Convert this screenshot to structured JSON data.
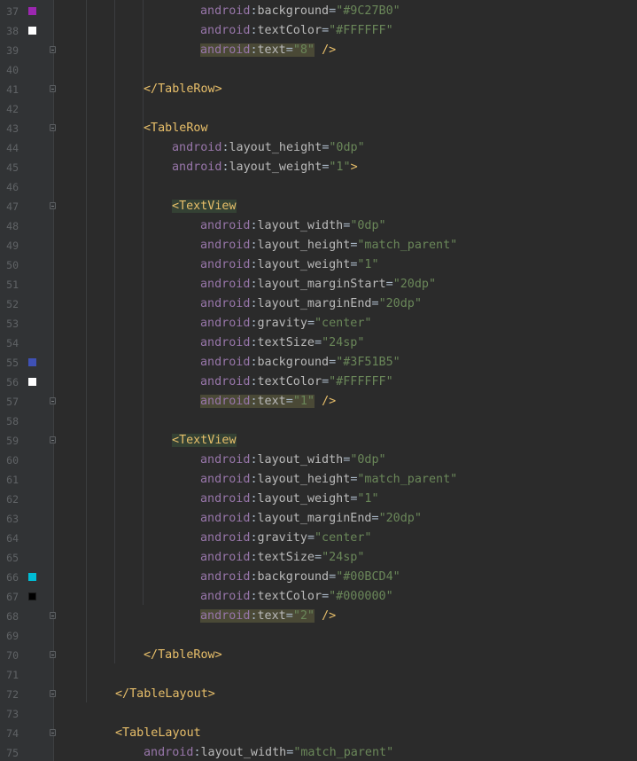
{
  "editor": {
    "colors": {
      "background": "#2b2b2b",
      "gutter": "#313335",
      "line_number": "#606366",
      "namespace": "#9876aa",
      "attribute": "#bababa",
      "value": "#6a8759",
      "tag": "#e8bf6a"
    },
    "lines": [
      {
        "num": "37",
        "indent": 4,
        "swatch": "#9C27B0",
        "fold": false,
        "tokens": [
          {
            "t": "ns",
            "s": "android"
          },
          {
            "t": "plain",
            "s": ":"
          },
          {
            "t": "attr",
            "s": "background"
          },
          {
            "t": "plain",
            "s": "="
          },
          {
            "t": "val",
            "s": "\"#9C27B0\""
          }
        ]
      },
      {
        "num": "38",
        "indent": 4,
        "swatch": "#FFFFFF",
        "fold": false,
        "tokens": [
          {
            "t": "ns",
            "s": "android"
          },
          {
            "t": "plain",
            "s": ":"
          },
          {
            "t": "attr",
            "s": "textColor"
          },
          {
            "t": "plain",
            "s": "="
          },
          {
            "t": "val",
            "s": "\"#FFFFFF\""
          }
        ]
      },
      {
        "num": "39",
        "indent": 4,
        "fold": true,
        "tokens": [
          {
            "t": "ns",
            "s": "android",
            "hl": "text"
          },
          {
            "t": "plain",
            "s": ":",
            "hl": "text"
          },
          {
            "t": "attr",
            "s": "text",
            "hl": "text"
          },
          {
            "t": "plain",
            "s": "=",
            "hl": "text"
          },
          {
            "t": "val",
            "s": "\"8\"",
            "hl": "text"
          },
          {
            "t": "plain",
            "s": " "
          },
          {
            "t": "punc",
            "s": "/>"
          }
        ]
      },
      {
        "num": "40",
        "indent": 0,
        "fold": false,
        "tokens": []
      },
      {
        "num": "41",
        "indent": 2,
        "fold": true,
        "tokens": [
          {
            "t": "tag",
            "s": "</TableRow>"
          }
        ]
      },
      {
        "num": "42",
        "indent": 0,
        "fold": false,
        "tokens": []
      },
      {
        "num": "43",
        "indent": 2,
        "fold": true,
        "tokens": [
          {
            "t": "tag",
            "s": "<TableRow"
          }
        ]
      },
      {
        "num": "44",
        "indent": 3,
        "fold": false,
        "tokens": [
          {
            "t": "ns",
            "s": "android"
          },
          {
            "t": "plain",
            "s": ":"
          },
          {
            "t": "attr",
            "s": "layout_height"
          },
          {
            "t": "plain",
            "s": "="
          },
          {
            "t": "val",
            "s": "\"0dp\""
          }
        ]
      },
      {
        "num": "45",
        "indent": 3,
        "fold": false,
        "tokens": [
          {
            "t": "ns",
            "s": "android"
          },
          {
            "t": "plain",
            "s": ":"
          },
          {
            "t": "attr",
            "s": "layout_weight"
          },
          {
            "t": "plain",
            "s": "="
          },
          {
            "t": "val",
            "s": "\"1\""
          },
          {
            "t": "punc",
            "s": ">"
          }
        ]
      },
      {
        "num": "46",
        "indent": 0,
        "fold": false,
        "tokens": []
      },
      {
        "num": "47",
        "indent": 3,
        "fold": true,
        "tokens": [
          {
            "t": "tag",
            "s": "<",
            "hl": "tag"
          },
          {
            "t": "tag",
            "s": "TextView",
            "hl": "tag"
          }
        ]
      },
      {
        "num": "48",
        "indent": 4,
        "fold": false,
        "tokens": [
          {
            "t": "ns",
            "s": "android"
          },
          {
            "t": "plain",
            "s": ":"
          },
          {
            "t": "attr",
            "s": "layout_width"
          },
          {
            "t": "plain",
            "s": "="
          },
          {
            "t": "val",
            "s": "\"0dp\""
          }
        ]
      },
      {
        "num": "49",
        "indent": 4,
        "fold": false,
        "tokens": [
          {
            "t": "ns",
            "s": "android"
          },
          {
            "t": "plain",
            "s": ":"
          },
          {
            "t": "attr",
            "s": "layout_height"
          },
          {
            "t": "plain",
            "s": "="
          },
          {
            "t": "val",
            "s": "\"match_parent\""
          }
        ]
      },
      {
        "num": "50",
        "indent": 4,
        "fold": false,
        "tokens": [
          {
            "t": "ns",
            "s": "android"
          },
          {
            "t": "plain",
            "s": ":"
          },
          {
            "t": "attr",
            "s": "layout_weight"
          },
          {
            "t": "plain",
            "s": "="
          },
          {
            "t": "val",
            "s": "\"1\""
          }
        ]
      },
      {
        "num": "51",
        "indent": 4,
        "fold": false,
        "tokens": [
          {
            "t": "ns",
            "s": "android"
          },
          {
            "t": "plain",
            "s": ":"
          },
          {
            "t": "attr",
            "s": "layout_marginStart"
          },
          {
            "t": "plain",
            "s": "="
          },
          {
            "t": "val",
            "s": "\"20dp\""
          }
        ]
      },
      {
        "num": "52",
        "indent": 4,
        "fold": false,
        "tokens": [
          {
            "t": "ns",
            "s": "android"
          },
          {
            "t": "plain",
            "s": ":"
          },
          {
            "t": "attr",
            "s": "layout_marginEnd"
          },
          {
            "t": "plain",
            "s": "="
          },
          {
            "t": "val",
            "s": "\"20dp\""
          }
        ]
      },
      {
        "num": "53",
        "indent": 4,
        "fold": false,
        "tokens": [
          {
            "t": "ns",
            "s": "android"
          },
          {
            "t": "plain",
            "s": ":"
          },
          {
            "t": "attr",
            "s": "gravity"
          },
          {
            "t": "plain",
            "s": "="
          },
          {
            "t": "val",
            "s": "\"center\""
          }
        ]
      },
      {
        "num": "54",
        "indent": 4,
        "fold": false,
        "tokens": [
          {
            "t": "ns",
            "s": "android"
          },
          {
            "t": "plain",
            "s": ":"
          },
          {
            "t": "attr",
            "s": "textSize"
          },
          {
            "t": "plain",
            "s": "="
          },
          {
            "t": "val",
            "s": "\"24sp\""
          }
        ]
      },
      {
        "num": "55",
        "indent": 4,
        "swatch": "#3F51B5",
        "fold": false,
        "tokens": [
          {
            "t": "ns",
            "s": "android"
          },
          {
            "t": "plain",
            "s": ":"
          },
          {
            "t": "attr",
            "s": "background"
          },
          {
            "t": "plain",
            "s": "="
          },
          {
            "t": "val",
            "s": "\"#3F51B5\""
          }
        ]
      },
      {
        "num": "56",
        "indent": 4,
        "swatch": "#FFFFFF",
        "fold": false,
        "tokens": [
          {
            "t": "ns",
            "s": "android"
          },
          {
            "t": "plain",
            "s": ":"
          },
          {
            "t": "attr",
            "s": "textColor"
          },
          {
            "t": "plain",
            "s": "="
          },
          {
            "t": "val",
            "s": "\"#FFFFFF\""
          }
        ]
      },
      {
        "num": "57",
        "indent": 4,
        "fold": true,
        "tokens": [
          {
            "t": "ns",
            "s": "android",
            "hl": "text"
          },
          {
            "t": "plain",
            "s": ":",
            "hl": "text"
          },
          {
            "t": "attr",
            "s": "text",
            "hl": "text"
          },
          {
            "t": "plain",
            "s": "=",
            "hl": "text"
          },
          {
            "t": "val",
            "s": "\"1\"",
            "hl": "text"
          },
          {
            "t": "plain",
            "s": " "
          },
          {
            "t": "punc",
            "s": "/>"
          }
        ]
      },
      {
        "num": "58",
        "indent": 0,
        "fold": false,
        "tokens": []
      },
      {
        "num": "59",
        "indent": 3,
        "fold": true,
        "tokens": [
          {
            "t": "tag",
            "s": "<",
            "hl": "tag"
          },
          {
            "t": "tag",
            "s": "TextView",
            "hl": "tag"
          }
        ]
      },
      {
        "num": "60",
        "indent": 4,
        "fold": false,
        "tokens": [
          {
            "t": "ns",
            "s": "android"
          },
          {
            "t": "plain",
            "s": ":"
          },
          {
            "t": "attr",
            "s": "layout_width"
          },
          {
            "t": "plain",
            "s": "="
          },
          {
            "t": "val",
            "s": "\"0dp\""
          }
        ]
      },
      {
        "num": "61",
        "indent": 4,
        "fold": false,
        "tokens": [
          {
            "t": "ns",
            "s": "android"
          },
          {
            "t": "plain",
            "s": ":"
          },
          {
            "t": "attr",
            "s": "layout_height"
          },
          {
            "t": "plain",
            "s": "="
          },
          {
            "t": "val",
            "s": "\"match_parent\""
          }
        ]
      },
      {
        "num": "62",
        "indent": 4,
        "fold": false,
        "tokens": [
          {
            "t": "ns",
            "s": "android"
          },
          {
            "t": "plain",
            "s": ":"
          },
          {
            "t": "attr",
            "s": "layout_weight"
          },
          {
            "t": "plain",
            "s": "="
          },
          {
            "t": "val",
            "s": "\"1\""
          }
        ]
      },
      {
        "num": "63",
        "indent": 4,
        "fold": false,
        "tokens": [
          {
            "t": "ns",
            "s": "android"
          },
          {
            "t": "plain",
            "s": ":"
          },
          {
            "t": "attr",
            "s": "layout_marginEnd"
          },
          {
            "t": "plain",
            "s": "="
          },
          {
            "t": "val",
            "s": "\"20dp\""
          }
        ]
      },
      {
        "num": "64",
        "indent": 4,
        "fold": false,
        "tokens": [
          {
            "t": "ns",
            "s": "android"
          },
          {
            "t": "plain",
            "s": ":"
          },
          {
            "t": "attr",
            "s": "gravity"
          },
          {
            "t": "plain",
            "s": "="
          },
          {
            "t": "val",
            "s": "\"center\""
          }
        ]
      },
      {
        "num": "65",
        "indent": 4,
        "fold": false,
        "tokens": [
          {
            "t": "ns",
            "s": "android"
          },
          {
            "t": "plain",
            "s": ":"
          },
          {
            "t": "attr",
            "s": "textSize"
          },
          {
            "t": "plain",
            "s": "="
          },
          {
            "t": "val",
            "s": "\"24sp\""
          }
        ]
      },
      {
        "num": "66",
        "indent": 4,
        "swatch": "#00BCD4",
        "fold": false,
        "tokens": [
          {
            "t": "ns",
            "s": "android"
          },
          {
            "t": "plain",
            "s": ":"
          },
          {
            "t": "attr",
            "s": "background"
          },
          {
            "t": "plain",
            "s": "="
          },
          {
            "t": "val",
            "s": "\"#00BCD4\""
          }
        ]
      },
      {
        "num": "67",
        "indent": 4,
        "swatch": "#000000",
        "fold": false,
        "tokens": [
          {
            "t": "ns",
            "s": "android"
          },
          {
            "t": "plain",
            "s": ":"
          },
          {
            "t": "attr",
            "s": "textColor"
          },
          {
            "t": "plain",
            "s": "="
          },
          {
            "t": "val",
            "s": "\"#000000\""
          }
        ]
      },
      {
        "num": "68",
        "indent": 4,
        "fold": true,
        "tokens": [
          {
            "t": "ns",
            "s": "android",
            "hl": "text"
          },
          {
            "t": "plain",
            "s": ":",
            "hl": "text"
          },
          {
            "t": "attr",
            "s": "text",
            "hl": "text"
          },
          {
            "t": "plain",
            "s": "=",
            "hl": "text"
          },
          {
            "t": "val",
            "s": "\"2\"",
            "hl": "text"
          },
          {
            "t": "plain",
            "s": " "
          },
          {
            "t": "punc",
            "s": "/>"
          }
        ]
      },
      {
        "num": "69",
        "indent": 0,
        "fold": false,
        "tokens": []
      },
      {
        "num": "70",
        "indent": 2,
        "fold": true,
        "tokens": [
          {
            "t": "tag",
            "s": "</TableRow>"
          }
        ]
      },
      {
        "num": "71",
        "indent": 0,
        "fold": false,
        "tokens": []
      },
      {
        "num": "72",
        "indent": 1,
        "fold": true,
        "tokens": [
          {
            "t": "tag",
            "s": "</TableLayout>"
          }
        ]
      },
      {
        "num": "73",
        "indent": 0,
        "fold": false,
        "tokens": []
      },
      {
        "num": "74",
        "indent": 1,
        "fold": true,
        "tokens": [
          {
            "t": "tag",
            "s": "<TableLayout"
          }
        ]
      },
      {
        "num": "75",
        "indent": 2,
        "fold": false,
        "tokens": [
          {
            "t": "ns",
            "s": "android"
          },
          {
            "t": "plain",
            "s": ":"
          },
          {
            "t": "attr",
            "s": "layout_width"
          },
          {
            "t": "plain",
            "s": "="
          },
          {
            "t": "val",
            "s": "\"match_parent\""
          }
        ]
      }
    ]
  }
}
